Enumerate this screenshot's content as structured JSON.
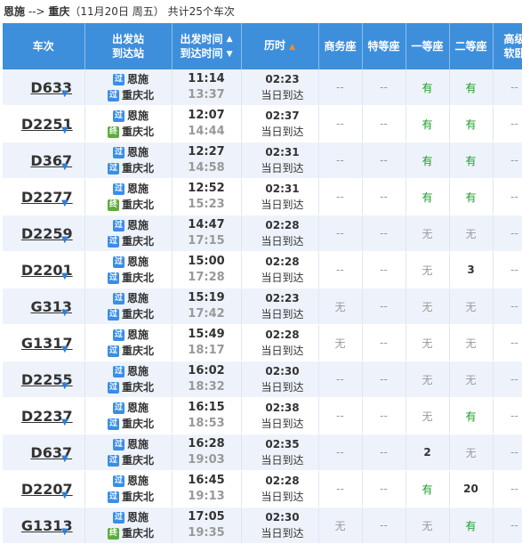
{
  "route": {
    "origin": "恩施",
    "arrow": "-->",
    "destination": "重庆",
    "date_text": "（11月20日  周五）",
    "count_text": "共计25个车次"
  },
  "headers": {
    "train": "车次",
    "station_line1": "出发站",
    "station_line2": "到达站",
    "time_line1": "出发时间",
    "time_line2": "到达时间",
    "duration": "历时",
    "business": "商务座",
    "special": "特等座",
    "first": "一等座",
    "second": "二等座",
    "high_line1": "高级",
    "high_line2": "软卧"
  },
  "badges": {
    "pass": "过",
    "end": "终"
  },
  "rows": [
    {
      "train": "D633",
      "from": "恩施",
      "from_badge": "过",
      "to": "重庆北",
      "to_badge": "过",
      "dep": "11:14",
      "arr": "13:37",
      "dur": "02:23",
      "arrive_day": "当日到达",
      "business": "--",
      "special": "--",
      "first": "有",
      "second": "有",
      "high": "--"
    },
    {
      "train": "D2251",
      "from": "恩施",
      "from_badge": "过",
      "to": "重庆北",
      "to_badge": "终",
      "dep": "12:07",
      "arr": "14:44",
      "dur": "02:37",
      "arrive_day": "当日到达",
      "business": "--",
      "special": "--",
      "first": "有",
      "second": "有",
      "high": "--"
    },
    {
      "train": "D367",
      "from": "恩施",
      "from_badge": "过",
      "to": "重庆北",
      "to_badge": "过",
      "dep": "12:27",
      "arr": "14:58",
      "dur": "02:31",
      "arrive_day": "当日到达",
      "business": "--",
      "special": "--",
      "first": "有",
      "second": "有",
      "high": "--"
    },
    {
      "train": "D2277",
      "from": "恩施",
      "from_badge": "过",
      "to": "重庆北",
      "to_badge": "终",
      "dep": "12:52",
      "arr": "15:23",
      "dur": "02:31",
      "arrive_day": "当日到达",
      "business": "--",
      "special": "--",
      "first": "有",
      "second": "有",
      "high": "--"
    },
    {
      "train": "D2259",
      "from": "恩施",
      "from_badge": "过",
      "to": "重庆北",
      "to_badge": "过",
      "dep": "14:47",
      "arr": "17:15",
      "dur": "02:28",
      "arrive_day": "当日到达",
      "business": "--",
      "special": "--",
      "first": "无",
      "second": "无",
      "high": "--"
    },
    {
      "train": "D2201",
      "from": "恩施",
      "from_badge": "过",
      "to": "重庆北",
      "to_badge": "过",
      "dep": "15:00",
      "arr": "17:28",
      "dur": "02:28",
      "arrive_day": "当日到达",
      "business": "--",
      "special": "--",
      "first": "无",
      "second": "3",
      "high": "--"
    },
    {
      "train": "G313",
      "from": "恩施",
      "from_badge": "过",
      "to": "重庆北",
      "to_badge": "过",
      "dep": "15:19",
      "arr": "17:42",
      "dur": "02:23",
      "arrive_day": "当日到达",
      "business": "无",
      "special": "--",
      "first": "无",
      "second": "无",
      "high": "--"
    },
    {
      "train": "G1317",
      "from": "恩施",
      "from_badge": "过",
      "to": "重庆北",
      "to_badge": "过",
      "dep": "15:49",
      "arr": "18:17",
      "dur": "02:28",
      "arrive_day": "当日到达",
      "business": "无",
      "special": "--",
      "first": "无",
      "second": "无",
      "high": "--"
    },
    {
      "train": "D2255",
      "from": "恩施",
      "from_badge": "过",
      "to": "重庆北",
      "to_badge": "过",
      "dep": "16:02",
      "arr": "18:32",
      "dur": "02:30",
      "arrive_day": "当日到达",
      "business": "--",
      "special": "--",
      "first": "无",
      "second": "无",
      "high": "--"
    },
    {
      "train": "D2237",
      "from": "恩施",
      "from_badge": "过",
      "to": "重庆北",
      "to_badge": "过",
      "dep": "16:15",
      "arr": "18:53",
      "dur": "02:38",
      "arrive_day": "当日到达",
      "business": "--",
      "special": "--",
      "first": "无",
      "second": "有",
      "high": "--"
    },
    {
      "train": "D637",
      "from": "恩施",
      "from_badge": "过",
      "to": "重庆北",
      "to_badge": "过",
      "dep": "16:28",
      "arr": "19:03",
      "dur": "02:35",
      "arrive_day": "当日到达",
      "business": "--",
      "special": "--",
      "first": "2",
      "second": "无",
      "high": "--"
    },
    {
      "train": "D2207",
      "from": "恩施",
      "from_badge": "过",
      "to": "重庆北",
      "to_badge": "过",
      "dep": "16:45",
      "arr": "19:13",
      "dur": "02:28",
      "arrive_day": "当日到达",
      "business": "--",
      "special": "--",
      "first": "有",
      "second": "20",
      "high": "--"
    },
    {
      "train": "G1313",
      "from": "恩施",
      "from_badge": "过",
      "to": "重庆北",
      "to_badge": "终",
      "dep": "17:05",
      "arr": "19:35",
      "dur": "02:30",
      "arrive_day": "当日到达",
      "business": "无",
      "special": "--",
      "first": "无",
      "second": "有",
      "high": "--"
    }
  ]
}
